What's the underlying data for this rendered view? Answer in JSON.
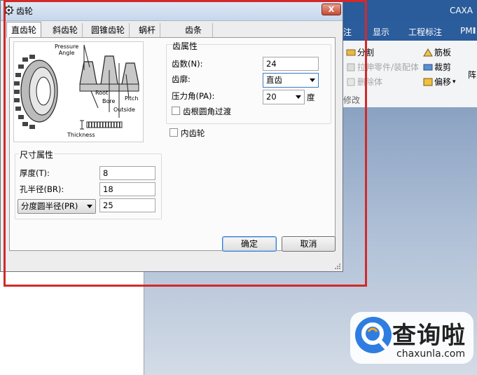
{
  "background_app": {
    "title": "CAXA",
    "ribbon_tabs": [
      "注",
      "显示",
      "工程标注",
      "PMI",
      "I"
    ],
    "ribbon_items": {
      "split": "分割",
      "rib": "筋板",
      "pull_part": "拉伸零件/装配体",
      "trim": "裁剪",
      "shell": "删除体",
      "offset": "偏移",
      "modify": "修改",
      "side": "阵"
    }
  },
  "dialog": {
    "title": "齿轮",
    "close_label": "X",
    "tabs": [
      "直齿轮",
      "斜齿轮",
      "圆锥齿轮",
      "蜗杆",
      "齿条"
    ],
    "active_tab": "直齿轮",
    "illustration_labels": {
      "pressure_angle": "Pressure\nAngle",
      "root": "Root",
      "bore": "Bore",
      "pitch": "Pitch",
      "outside": "Outside",
      "thickness": "Thickness"
    },
    "tooth_props": {
      "title": "齿属性",
      "teeth_label": "齿数(N):",
      "teeth_value": "24",
      "profile_label": "齿廓:",
      "profile_value": "直齿",
      "pressure_label": "压力角(PA):",
      "pressure_value": "20",
      "pressure_unit": "度",
      "root_fillet_label": "齿根圆角过渡",
      "root_fillet_checked": false,
      "internal_label": "内齿轮",
      "internal_checked": false
    },
    "size_props": {
      "title": "尺寸属性",
      "thickness_label": "厚度(T):",
      "thickness_value": "8",
      "bore_label": "孔半径(BR):",
      "bore_value": "18",
      "pitch_select": "分度圆半径(PR)",
      "pitch_value": "25"
    },
    "ok_label": "确定",
    "cancel_label": "取消"
  },
  "watermark": {
    "cn": "查询啦",
    "url": "chaxunla.com"
  }
}
